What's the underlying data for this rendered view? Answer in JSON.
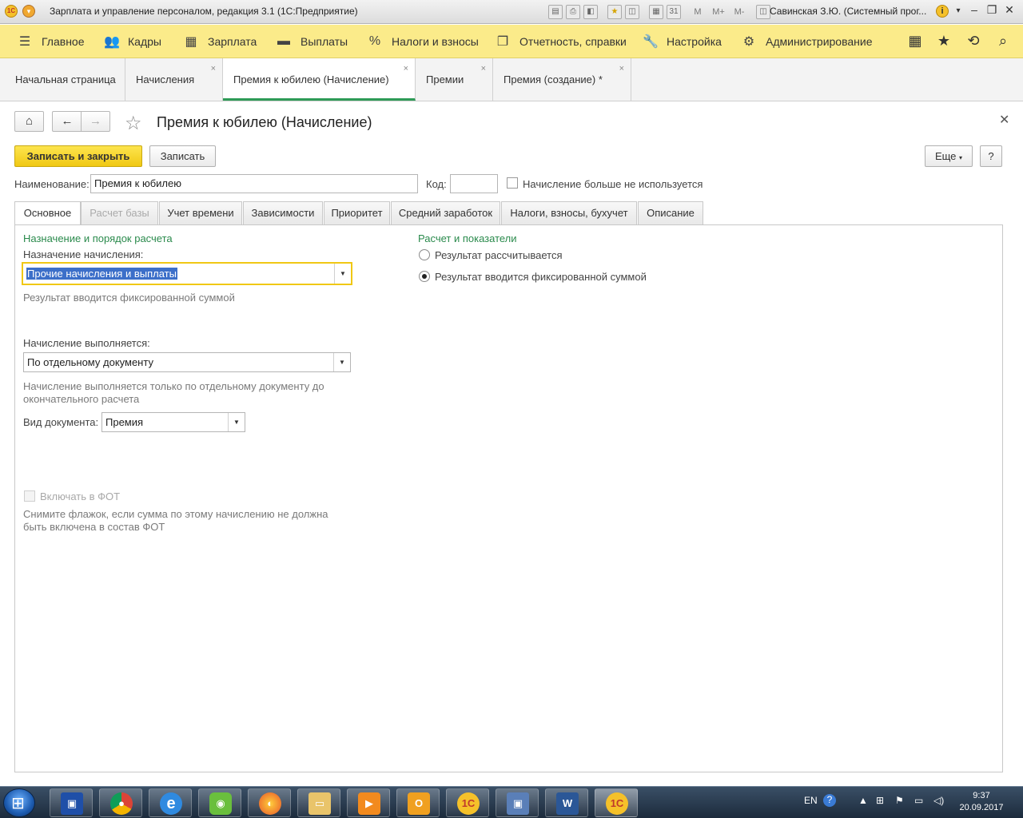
{
  "window": {
    "title": "Зарплата и управление персоналом, редакция 3.1  (1С:Предприятие)",
    "user": "Савинская З.Ю. (Системный прог...",
    "toolbar_m": [
      "M",
      "M+",
      "M-"
    ]
  },
  "main_menu": [
    {
      "label": "Главное",
      "icon": "hamburger-icon"
    },
    {
      "label": "Кадры",
      "icon": "people-icon"
    },
    {
      "label": "Зарплата",
      "icon": "calculator-icon"
    },
    {
      "label": "Выплаты",
      "icon": "wallet-icon"
    },
    {
      "label": "Налоги и взносы",
      "icon": "percent-icon"
    },
    {
      "label": "Отчетность, справки",
      "icon": "documents-icon"
    },
    {
      "label": "Настройка",
      "icon": "wrench-icon"
    },
    {
      "label": "Администрирование",
      "icon": "gear-icon"
    }
  ],
  "open_tabs": [
    {
      "label": "Начальная страница",
      "closable": false
    },
    {
      "label": "Начисления",
      "closable": true
    },
    {
      "label": "Премия к юбилею (Начисление)",
      "closable": true,
      "active": true
    },
    {
      "label": "Премии",
      "closable": true
    },
    {
      "label": "Премия (создание) *",
      "closable": true
    }
  ],
  "form": {
    "title": "Премия к юбилею (Начисление)",
    "save_close": "Записать и закрыть",
    "save": "Записать",
    "more": "Еще",
    "help": "?",
    "name_label": "Наименование:",
    "name_value": "Премия к юбилею",
    "code_label": "Код:",
    "code_value": "",
    "not_used_label": "Начисление больше не используется"
  },
  "tabs": [
    {
      "label": "Основное",
      "state": "active"
    },
    {
      "label": "Расчет базы",
      "state": "disabled"
    },
    {
      "label": "Учет времени",
      "state": "normal"
    },
    {
      "label": "Зависимости",
      "state": "normal"
    },
    {
      "label": "Приоритет",
      "state": "normal"
    },
    {
      "label": "Средний заработок",
      "state": "normal"
    },
    {
      "label": "Налоги, взносы, бухучет",
      "state": "normal"
    },
    {
      "label": "Описание",
      "state": "normal"
    }
  ],
  "main_tab": {
    "section_left": "Назначение и порядок расчета",
    "purpose_label": "Назначение начисления:",
    "purpose_value": "Прочие начисления и выплаты",
    "purpose_hint": "Результат вводится фиксированной суммой",
    "exec_label": "Начисление выполняется:",
    "exec_value": "По отдельному документу",
    "exec_hint": "Начисление выполняется только по отдельному документу до окончательного расчета",
    "doctype_label": "Вид документа:",
    "doctype_value": "Премия",
    "fot_label": "Включать в ФОТ",
    "fot_hint": "Снимите флажок, если сумма по этому начислению не должна быть включена в состав ФОТ",
    "section_right": "Расчет и показатели",
    "radio_calc": "Результат рассчитывается",
    "radio_fixed": "Результат вводится фиксированной суммой"
  },
  "taskbar": {
    "lang": "EN",
    "time": "9:37",
    "date": "20.09.2017"
  }
}
